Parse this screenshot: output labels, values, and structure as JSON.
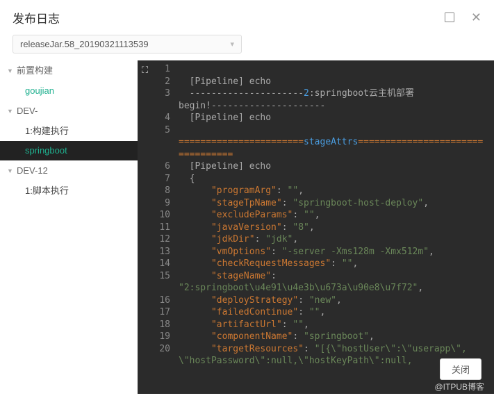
{
  "header": {
    "title": "发布日志"
  },
  "select": {
    "value": "releaseJar.58_20190321113539"
  },
  "sidebar": {
    "groups": [
      {
        "label": "前置构建",
        "children": [
          {
            "label": "goujian",
            "cls": "green"
          }
        ]
      },
      {
        "label": "DEV-",
        "children": [
          {
            "label": "1:构建执行",
            "cls": ""
          },
          {
            "label": "springboot",
            "cls": "selected"
          }
        ]
      },
      {
        "label": "DEV-12",
        "children": [
          {
            "label": "1:脚本执行",
            "cls": ""
          }
        ]
      }
    ]
  },
  "code": {
    "lines": [
      {
        "n": 1,
        "segs": [
          {
            "t": "",
            "c": ""
          }
        ]
      },
      {
        "n": 2,
        "segs": [
          {
            "t": "[Pipeline] echo",
            "c": ""
          }
        ]
      },
      {
        "n": 3,
        "segs": [
          {
            "t": "---------------------",
            "c": ""
          },
          {
            "t": "2",
            "c": "cyan"
          },
          {
            "t": ":springboot云主机部署 ",
            "c": ""
          }
        ]
      },
      {
        "n": "",
        "segs": [
          {
            "t": "begin!",
            "c": ""
          },
          {
            "t": "---------------------",
            "c": ""
          }
        ],
        "noindent": true
      },
      {
        "n": 4,
        "segs": [
          {
            "t": "[Pipeline] echo",
            "c": ""
          }
        ]
      },
      {
        "n": 5,
        "segs": [
          {
            "t": "",
            "c": ""
          }
        ]
      },
      {
        "n": "",
        "segs": [
          {
            "t": "=======================",
            "c": "orange"
          },
          {
            "t": "stageAttrs",
            "c": "cyan"
          },
          {
            "t": "=======================",
            "c": "orange"
          }
        ],
        "noindent": true
      },
      {
        "n": "",
        "segs": [
          {
            "t": "==========",
            "c": "orange"
          }
        ],
        "noindent": true
      },
      {
        "n": 6,
        "segs": [
          {
            "t": "[Pipeline] echo",
            "c": ""
          }
        ]
      },
      {
        "n": 7,
        "segs": [
          {
            "t": "{",
            "c": ""
          }
        ]
      },
      {
        "n": 8,
        "segs": [
          {
            "t": "    ",
            "c": ""
          },
          {
            "t": "\"programArg\"",
            "c": "orange"
          },
          {
            "t": ": ",
            "c": ""
          },
          {
            "t": "\"\"",
            "c": "green-str"
          },
          {
            "t": ",",
            "c": ""
          }
        ]
      },
      {
        "n": 9,
        "segs": [
          {
            "t": "    ",
            "c": ""
          },
          {
            "t": "\"stageTpName\"",
            "c": "orange"
          },
          {
            "t": ": ",
            "c": ""
          },
          {
            "t": "\"springboot-host-deploy\"",
            "c": "green-str"
          },
          {
            "t": ",",
            "c": ""
          }
        ]
      },
      {
        "n": 10,
        "segs": [
          {
            "t": "    ",
            "c": ""
          },
          {
            "t": "\"excludeParams\"",
            "c": "orange"
          },
          {
            "t": ": ",
            "c": ""
          },
          {
            "t": "\"\"",
            "c": "green-str"
          },
          {
            "t": ",",
            "c": ""
          }
        ]
      },
      {
        "n": 11,
        "segs": [
          {
            "t": "    ",
            "c": ""
          },
          {
            "t": "\"javaVersion\"",
            "c": "orange"
          },
          {
            "t": ": ",
            "c": ""
          },
          {
            "t": "\"8\"",
            "c": "green-str"
          },
          {
            "t": ",",
            "c": ""
          }
        ]
      },
      {
        "n": 12,
        "segs": [
          {
            "t": "    ",
            "c": ""
          },
          {
            "t": "\"jdkDir\"",
            "c": "orange"
          },
          {
            "t": ": ",
            "c": ""
          },
          {
            "t": "\"jdk\"",
            "c": "green-str"
          },
          {
            "t": ",",
            "c": ""
          }
        ]
      },
      {
        "n": 13,
        "segs": [
          {
            "t": "    ",
            "c": ""
          },
          {
            "t": "\"vmOptions\"",
            "c": "orange"
          },
          {
            "t": ": ",
            "c": ""
          },
          {
            "t": "\"-server -Xms128m -Xmx512m\"",
            "c": "green-str"
          },
          {
            "t": ",",
            "c": ""
          }
        ]
      },
      {
        "n": 14,
        "segs": [
          {
            "t": "    ",
            "c": ""
          },
          {
            "t": "\"checkRequestMessages\"",
            "c": "orange"
          },
          {
            "t": ": ",
            "c": ""
          },
          {
            "t": "\"\"",
            "c": "green-str"
          },
          {
            "t": ",",
            "c": ""
          }
        ]
      },
      {
        "n": 15,
        "segs": [
          {
            "t": "    ",
            "c": ""
          },
          {
            "t": "\"stageName\"",
            "c": "orange"
          },
          {
            "t": ": ",
            "c": ""
          }
        ]
      },
      {
        "n": "",
        "segs": [
          {
            "t": "\"2:springboot\\u4e91\\u4e3b\\u673a\\u90e8\\u7f72\"",
            "c": "green-str"
          },
          {
            "t": ",",
            "c": ""
          }
        ],
        "noindent": true
      },
      {
        "n": 16,
        "segs": [
          {
            "t": "    ",
            "c": ""
          },
          {
            "t": "\"deployStrategy\"",
            "c": "orange"
          },
          {
            "t": ": ",
            "c": ""
          },
          {
            "t": "\"new\"",
            "c": "green-str"
          },
          {
            "t": ",",
            "c": ""
          }
        ]
      },
      {
        "n": 17,
        "segs": [
          {
            "t": "    ",
            "c": ""
          },
          {
            "t": "\"failedContinue\"",
            "c": "orange"
          },
          {
            "t": ": ",
            "c": ""
          },
          {
            "t": "\"\"",
            "c": "green-str"
          },
          {
            "t": ",",
            "c": ""
          }
        ]
      },
      {
        "n": 18,
        "segs": [
          {
            "t": "    ",
            "c": ""
          },
          {
            "t": "\"artifactUrl\"",
            "c": "orange"
          },
          {
            "t": ": ",
            "c": ""
          },
          {
            "t": "\"\"",
            "c": "green-str"
          },
          {
            "t": ",",
            "c": ""
          }
        ]
      },
      {
        "n": 19,
        "segs": [
          {
            "t": "    ",
            "c": ""
          },
          {
            "t": "\"componentName\"",
            "c": "orange"
          },
          {
            "t": ": ",
            "c": ""
          },
          {
            "t": "\"springboot\"",
            "c": "green-str"
          },
          {
            "t": ",",
            "c": ""
          }
        ]
      },
      {
        "n": 20,
        "segs": [
          {
            "t": "    ",
            "c": ""
          },
          {
            "t": "\"targetResources\"",
            "c": "orange"
          },
          {
            "t": ": ",
            "c": ""
          },
          {
            "t": "\"[{\\\"hostUser\\\":\\\"userapp\\\",",
            "c": "green-str"
          }
        ]
      },
      {
        "n": "",
        "segs": [
          {
            "t": "\\\"hostPassword\\\":null,\\\"hostKeyPath\\\":null,",
            "c": "green-str"
          }
        ],
        "noindent": true
      }
    ]
  },
  "footer": {
    "close": "关闭",
    "watermark": "@ITPUB博客"
  }
}
